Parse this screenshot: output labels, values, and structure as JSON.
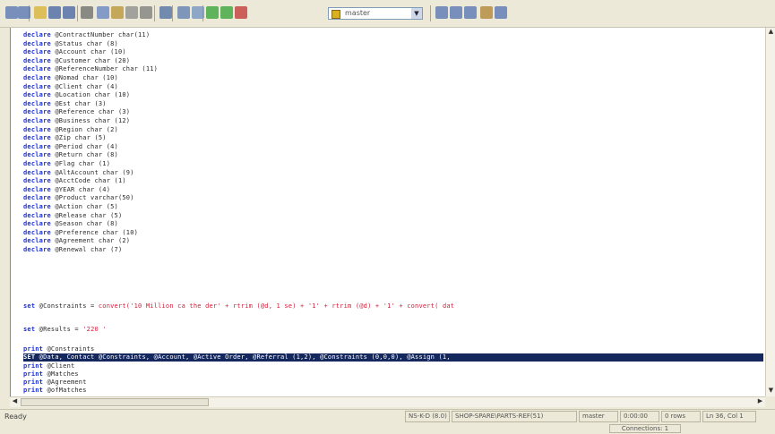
{
  "toolbar": {
    "buttons": [
      {
        "name": "new-query-icon",
        "color": "#5070b0"
      },
      {
        "name": "new-dropdown-icon",
        "color": "#5070b0"
      },
      {
        "name": "open-folder-icon",
        "color": "#d8b030"
      },
      {
        "name": "save-icon",
        "color": "#4060a0"
      },
      {
        "name": "save-all-icon",
        "color": "#4060a0"
      },
      {
        "name": "cut-icon",
        "color": "#6a6a6a"
      },
      {
        "name": "copy-icon",
        "color": "#6080c0"
      },
      {
        "name": "paste-icon",
        "color": "#b89030"
      },
      {
        "name": "clear-icon",
        "color": "#8a8a8a"
      },
      {
        "name": "find-icon",
        "color": "#7a7a7a"
      },
      {
        "name": "undo-icon",
        "color": "#4a6aa0"
      },
      {
        "name": "insert-template-icon",
        "color": "#5a7ab0"
      },
      {
        "name": "query-type-icon",
        "color": "#7090c0"
      },
      {
        "name": "parse-check-icon",
        "color": "#30a030"
      },
      {
        "name": "execute-icon",
        "color": "#30a030"
      },
      {
        "name": "stop-icon",
        "color": "#c03030"
      }
    ],
    "database_selector": {
      "value": "master"
    },
    "right_buttons": [
      {
        "name": "execution-plan-icon",
        "color": "#5070b0"
      },
      {
        "name": "index-tuning-icon",
        "color": "#5070b0"
      },
      {
        "name": "results-grid-icon",
        "color": "#5070b0"
      },
      {
        "name": "object-browser-icon",
        "color": "#b08030"
      },
      {
        "name": "object-search-icon",
        "color": "#5070b0"
      }
    ]
  },
  "editor": {
    "declarations": [
      {
        "kw": "declare",
        "text": " @ContractNumber char(11)"
      },
      {
        "kw": "declare",
        "text": " @Status char (8)"
      },
      {
        "kw": "declare",
        "text": " @Account char (10)"
      },
      {
        "kw": "declare",
        "text": " @Customer char (20)"
      },
      {
        "kw": "declare",
        "text": " @ReferenceNumber char (11)"
      },
      {
        "kw": "declare",
        "text": " @Nomad char (10)"
      },
      {
        "kw": "declare",
        "text": " @Client char (4)"
      },
      {
        "kw": "declare",
        "text": " @Location char (10)"
      },
      {
        "kw": "declare",
        "text": " @Est char (3)"
      },
      {
        "kw": "declare",
        "text": " @Reference char (3)"
      },
      {
        "kw": "declare",
        "text": " @Business char (12)"
      },
      {
        "kw": "declare",
        "text": " @Region char (2)"
      },
      {
        "kw": "declare",
        "text": " @Zip char (5)"
      },
      {
        "kw": "declare",
        "text": " @Period char (4)"
      },
      {
        "kw": "declare",
        "text": " @Return char (8)"
      },
      {
        "kw": "declare",
        "text": " @Flag char (1)"
      },
      {
        "kw": "declare",
        "text": " @AltAccount char (9)"
      },
      {
        "kw": "declare",
        "text": " @AcctCode char (1)"
      },
      {
        "kw": "declare",
        "text": " @YEAR char (4)"
      },
      {
        "kw": "declare",
        "text": " @Product varchar(50)"
      },
      {
        "kw": "declare",
        "text": " @Action char (5)"
      },
      {
        "kw": "declare",
        "text": " @Release char (5)"
      },
      {
        "kw": "declare",
        "text": " @Season char (8)"
      },
      {
        "kw": "declare",
        "text": " @Preference char (10)"
      },
      {
        "kw": "declare",
        "text": " @Agreement char (2)"
      },
      {
        "kw": "declare",
        "text": " @Renewal char (7)"
      }
    ],
    "set_line": {
      "kw": "set",
      "text": " @Constraints = ",
      "str": "convert('10 Million ca the der' + rtrim (@d, 1 se) + '1' + rtrim (@d) + '1' + convert( dat"
    },
    "set_line2": {
      "kw": "set",
      "text": " @Results = ",
      "str": "'220 '"
    },
    "print_line": {
      "kw": "print",
      "text": " @Constraints"
    },
    "highlighted_line": {
      "kw": "SET",
      "text": " @Data, Contact @Constraints, @Account, @Active Order, @Referral (1,2), @Constraints (0,0,0), @Assign (1,"
    },
    "print_lines": [
      {
        "kw": "print",
        "text": " @Client"
      },
      {
        "kw": "print",
        "text": " @Matches"
      },
      {
        "kw": "print",
        "text": " @Agreement"
      },
      {
        "kw": "print",
        "text": " @ofMatches"
      }
    ]
  },
  "status": {
    "ready": "Ready",
    "panels": [
      "NS-K-D (8.0)",
      "SHOP-SPARE\\PARTS-REF(51)",
      "master",
      "0:00:00",
      "0 rows",
      "Ln 36, Col 1"
    ],
    "connections": "Connections: 1"
  }
}
